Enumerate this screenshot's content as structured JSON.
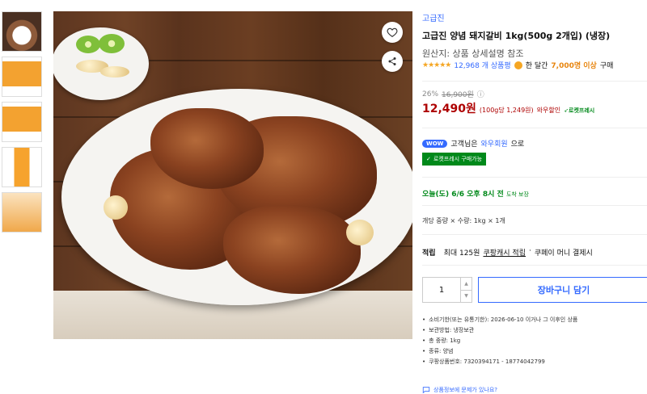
{
  "gallery": {
    "thumbnails": [
      "meat",
      "meat",
      "meat",
      "dark",
      "meat",
      "pack",
      "pack",
      "tall",
      "doc"
    ]
  },
  "product": {
    "brand": "고급진",
    "title": "고급진 양념 돼지갈비 1kg(500g 2개입) (냉장)",
    "origin": "원산지: 상품 상세설명 참조",
    "stars": "★★★★★",
    "review_count": "12,968 개 상품평",
    "month_sales_prefix": "한 달간",
    "month_sales_count": "7,000명 이상",
    "month_sales_suffix": "구매"
  },
  "pricing": {
    "discount": "26%",
    "original_price": "16,900원",
    "info_icon": "ⓘ",
    "price": "12,490원",
    "unit_price": "(100g당 1,249원)",
    "wow_label": "와우할인",
    "rocket_label": "로켓프레시"
  },
  "wow": {
    "badge": "WOW",
    "prefix": "고객님은",
    "link": "와우회원",
    "suffix": "으로",
    "rocket_badge": "로켓프레시 구매가능"
  },
  "delivery": {
    "text": "오늘(도) 6/6 오후 8시 전",
    "sub": "도착 보장"
  },
  "option": {
    "text": "개당 중량 × 수량: 1kg × 1개"
  },
  "points": {
    "label": "적립",
    "max": "최대 125원",
    "link": "쿠팡캐시 적립",
    "sep": "·",
    "rest": "쿠페이 머니 결제시"
  },
  "cart": {
    "quantity": "1",
    "add_label": "장바구니 담기"
  },
  "details": [
    "소비기한(또는 유통기한): 2026-06-10 이거나 그 이후인 상품",
    "보관방법: 냉장보관",
    "총 중량: 1kg",
    "종류: 양념",
    "쿠팡상품번호: 7320394171 - 18774042799"
  ],
  "report": {
    "label": "상품정보에 문제가 있나요?"
  },
  "colors": {
    "accent": "#346aff",
    "price": "#ae0000",
    "rocket": "#00891a",
    "star": "#f5a623"
  },
  "icons": {
    "favorite": "heart-icon",
    "share": "share-icon",
    "report": "chat-icon"
  }
}
